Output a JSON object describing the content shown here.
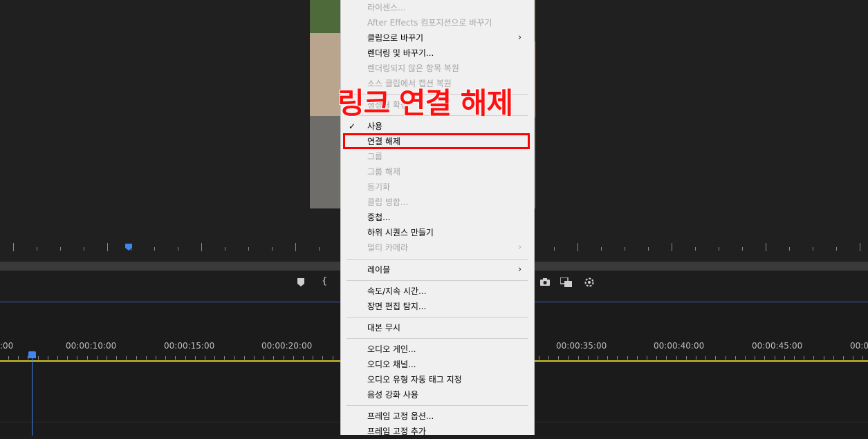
{
  "menu": {
    "items": [
      {
        "label": "라이센스...",
        "disabled": true
      },
      {
        "label": "After Effects 컴포지션으로 바꾸기",
        "disabled": true
      },
      {
        "label": "클립으로 바꾸기",
        "disabled": false,
        "submenu": true
      },
      {
        "label": "렌더링 및 바꾸기...",
        "disabled": false
      },
      {
        "label": "렌더링되지 않은 항목 복원",
        "disabled": true
      },
      {
        "label": "소스 클립에서 캡션 복원",
        "disabled": true
      },
      {
        "label": "생성형 확장",
        "disabled": true
      },
      {
        "label": "사용",
        "disabled": false,
        "checked": true
      },
      {
        "label": "연결 해제",
        "disabled": false
      },
      {
        "label": "그룹",
        "disabled": true
      },
      {
        "label": "그룹 해제",
        "disabled": true
      },
      {
        "label": "동기화",
        "disabled": true
      },
      {
        "label": "클립 병합...",
        "disabled": true
      },
      {
        "label": "중첩...",
        "disabled": false
      },
      {
        "label": "하위 시퀀스 만들기",
        "disabled": false
      },
      {
        "label": "멀티 카메라",
        "disabled": true,
        "submenu": true
      },
      {
        "label": "레이블",
        "disabled": false,
        "submenu": true
      },
      {
        "label": "속도/지속 시간...",
        "disabled": false
      },
      {
        "label": "장면 편집 탐지...",
        "disabled": false
      },
      {
        "label": "대본 무시",
        "disabled": false
      },
      {
        "label": "오디오 게인...",
        "disabled": false
      },
      {
        "label": "오디오 채널...",
        "disabled": false
      },
      {
        "label": "오디오 유형 자동 태그 지정",
        "disabled": false
      },
      {
        "label": "음성 강화 사용",
        "disabled": false
      },
      {
        "label": "프레임 고정 옵션...",
        "disabled": false
      },
      {
        "label": "프레임 고정 추가",
        "disabled": false
      }
    ],
    "checkmark": "✓",
    "submenu_arrow": "›"
  },
  "annotation": {
    "text": "링크 연결 해제",
    "color": "#ff1010"
  },
  "timeline": {
    "timecodes": [
      ":00",
      "00:00:10:00",
      "00:00:15:00",
      "00:00:20:00",
      "00:00:35:00",
      "00:00:40:00",
      "00:00:45:00",
      "00:0"
    ]
  },
  "controls": {
    "marker_icon": "marker-icon",
    "in_point_icon": "in-point-icon",
    "camera_icon": "camera-icon",
    "compare_icon": "compare-view-icon",
    "settings_icon": "settings-icon"
  },
  "colors": {
    "accent": "#3f86f0",
    "highlight": "#ff0000",
    "work_area": "#d2c62a"
  }
}
